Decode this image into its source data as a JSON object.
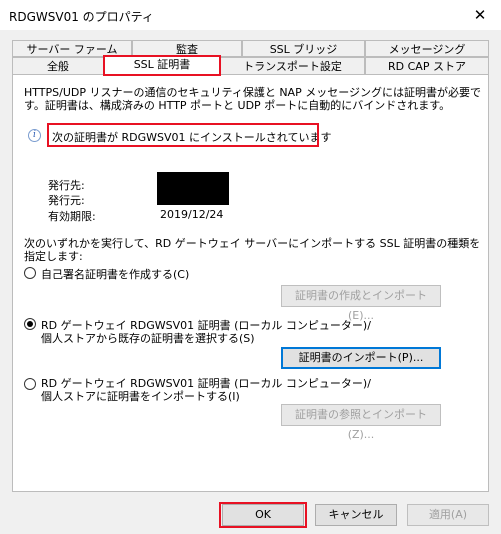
{
  "window": {
    "title": "RDGWSV01 のプロパティ",
    "close_glyph": "✕"
  },
  "tabs_row1": [
    "サーバー ファーム",
    "監査",
    "SSL ブリッジ",
    "メッセージング"
  ],
  "tabs_row2": [
    "全般",
    "SSL 証明書",
    "トランスポート設定",
    "RD CAP ストア"
  ],
  "panel": {
    "description_line1": "HTTPS/UDP リスナーの通信のセキュリティ保護と NAP メッセージングには証明書が必要で",
    "description_line2": "す。証明書は、構成済みの HTTP ポートと UDP ポートに自動的にバインドされます。",
    "installed_message": "次の証明書が RDGWSV01 にインストールされています",
    "cert_issued_to_label": "発行先:",
    "cert_issued_by_label": "発行元:",
    "cert_expiry_label": "有効期限:",
    "cert_expiry_value": "2019/12/24",
    "instruction_line1": "次のいずれかを実行して、RD ゲートウェイ サーバーにインポートする SSL 証明書の種類を",
    "instruction_line2": "指定します:",
    "option1_label": "自己署名証明書を作成する(C)",
    "option1_button": "証明書の作成とインポート(E)...",
    "option2_line1": "RD ゲートウェイ RDGWSV01 証明書 (ローカル コンピューター)/",
    "option2_line2": "個人ストアから既存の証明書を選択する(S)",
    "option2_button": "証明書のインポート(P)...",
    "option3_line1": "RD ゲートウェイ RDGWSV01 証明書 (ローカル コンピューター)/",
    "option3_line2": "個人ストアに証明書をインポートする(I)",
    "option3_button": "証明書の参照とインポート(Z)...",
    "selected_option": 2
  },
  "footer": {
    "ok": "OK",
    "cancel": "キャンセル",
    "apply": "適用(A)"
  },
  "colors": {
    "highlight": "#e81123",
    "default_button_border": "#0078d7"
  }
}
